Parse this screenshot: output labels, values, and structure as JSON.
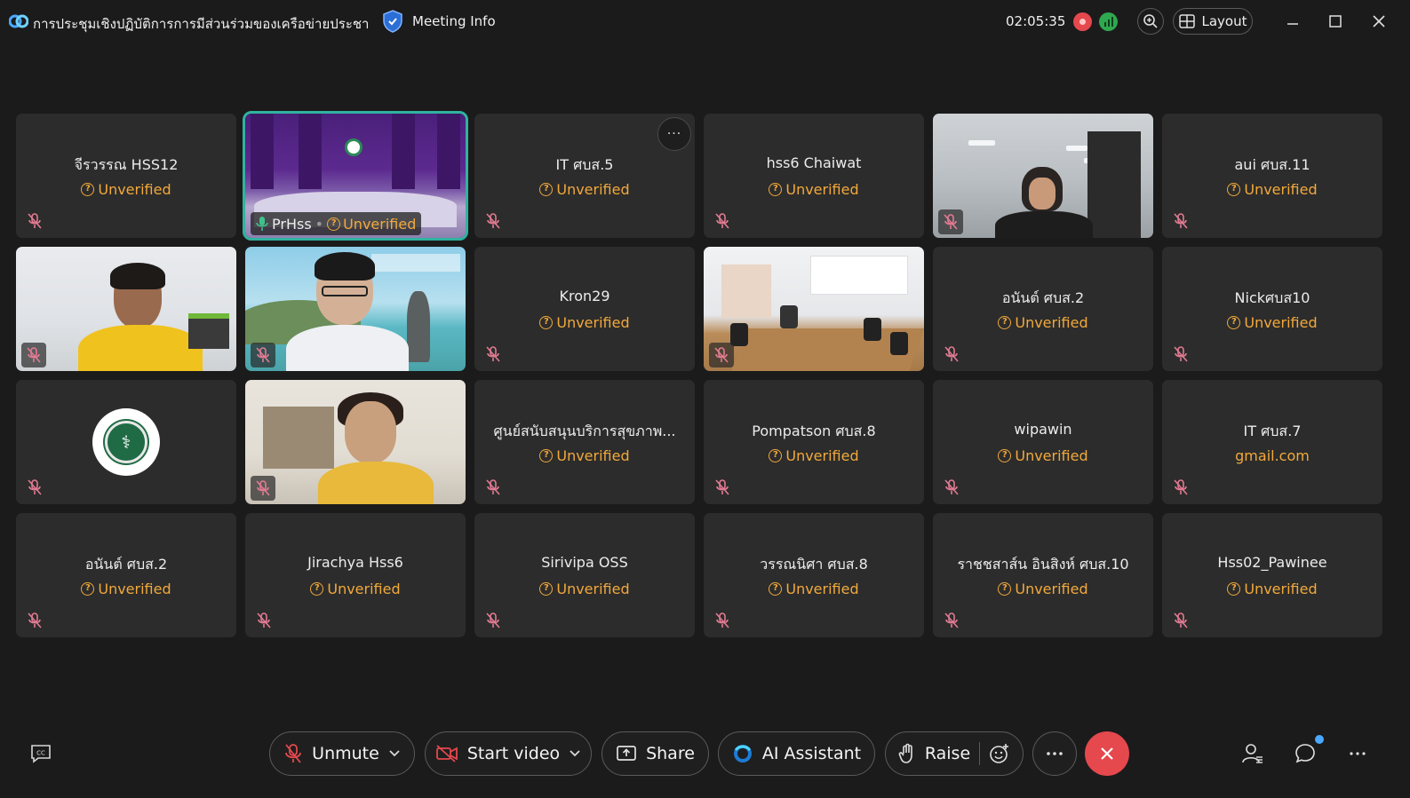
{
  "titlebar": {
    "meeting_title": "การประชุมเชิงปฏิบัติการการมีส่วนร่วมของเครือข่ายประชา...",
    "meeting_info_label": "Meeting Info",
    "timer": "02:05:35",
    "layout_label": "Layout"
  },
  "participants": [
    {
      "name": "จีรวรรณ HSS12",
      "status": "Unverified",
      "type": "audio"
    },
    {
      "name": "PrHss",
      "status": "Unverified",
      "type": "video",
      "speaking": true
    },
    {
      "name": "IT ศบส.5",
      "status": "Unverified",
      "type": "audio"
    },
    {
      "name": "hss6 Chaiwat",
      "status": "Unverified",
      "type": "audio"
    },
    {
      "name": "",
      "status": "",
      "type": "video"
    },
    {
      "name": "aui ศบส.11",
      "status": "Unverified",
      "type": "audio"
    },
    {
      "name": "",
      "status": "",
      "type": "video"
    },
    {
      "name": "",
      "status": "",
      "type": "video"
    },
    {
      "name": "Kron29",
      "status": "Unverified",
      "type": "audio"
    },
    {
      "name": "",
      "status": "",
      "type": "video"
    },
    {
      "name": "อนันต์ ศบส.2",
      "status": "Unverified",
      "type": "audio"
    },
    {
      "name": "Nickศบส10",
      "status": "Unverified",
      "type": "audio"
    },
    {
      "name": "",
      "status": "",
      "type": "avatar"
    },
    {
      "name": "",
      "status": "",
      "type": "video"
    },
    {
      "name": "ศูนย์สนับสนุนบริการสุขภาพ...",
      "status": "Unverified",
      "type": "audio"
    },
    {
      "name": "Pompatson ศบส.8",
      "status": "Unverified",
      "type": "audio"
    },
    {
      "name": "wipawin",
      "status": "Unverified",
      "type": "audio"
    },
    {
      "name": "IT ศบส.7",
      "status": "gmail.com",
      "type": "audio"
    },
    {
      "name": "อนันต์ ศบส.2",
      "status": "Unverified",
      "type": "audio"
    },
    {
      "name": "Jirachya Hss6",
      "status": "Unverified",
      "type": "audio"
    },
    {
      "name": "Sirivipa OSS",
      "status": "Unverified",
      "type": "audio"
    },
    {
      "name": "วรรณนิศา ศบส.8",
      "status": "Unverified",
      "type": "audio"
    },
    {
      "name": "ราชชสาส์น อินสิงห์ ศบส.10",
      "status": "Unverified",
      "type": "audio"
    },
    {
      "name": "Hss02_Pawinee",
      "status": "Unverified",
      "type": "audio"
    }
  ],
  "toolbar": {
    "unmute_label": "Unmute",
    "start_video_label": "Start video",
    "share_label": "Share",
    "ai_assistant_label": "AI Assistant",
    "raise_label": "Raise"
  },
  "colors": {
    "unverified": "#f2a93b",
    "end_call": "#e5484d",
    "active_speaker": "#2fb3a0"
  },
  "icons": {
    "muted": "mic-off-icon",
    "more": "more-horizontal-icon",
    "shield": "shield-icon"
  }
}
